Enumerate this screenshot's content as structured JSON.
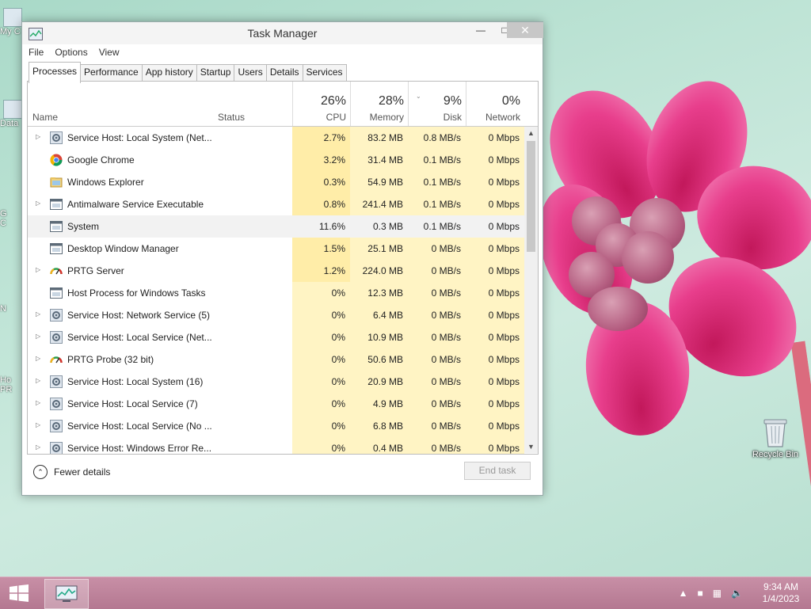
{
  "desktop": {
    "recycle_bin_label": "Recycle Bin",
    "left_labels": [
      "My C",
      "Data",
      "G",
      "C",
      "N",
      "Ho",
      "PR"
    ]
  },
  "window": {
    "title": "Task Manager",
    "menu": [
      "File",
      "Options",
      "View"
    ],
    "tabs": [
      "Processes",
      "Performance",
      "App history",
      "Startup",
      "Users",
      "Details",
      "Services"
    ],
    "active_tab": "Processes"
  },
  "columns": {
    "name": "Name",
    "status": "Status",
    "cpu": {
      "pct": "26%",
      "label": "CPU"
    },
    "memory": {
      "pct": "28%",
      "label": "Memory"
    },
    "disk": {
      "pct": "9%",
      "label": "Disk"
    },
    "network": {
      "pct": "0%",
      "label": "Network"
    }
  },
  "processes": [
    {
      "name": "Service Host: Local System (Net...",
      "cpu": "2.7%",
      "mem": "83.2 MB",
      "disk": "0.8 MB/s",
      "net": "0 Mbps",
      "icon": "gear-icon",
      "expandable": true
    },
    {
      "name": "Google Chrome",
      "cpu": "3.2%",
      "mem": "31.4 MB",
      "disk": "0.1 MB/s",
      "net": "0 Mbps",
      "icon": "chrome-icon",
      "expandable": false
    },
    {
      "name": "Windows Explorer",
      "cpu": "0.3%",
      "mem": "54.9 MB",
      "disk": "0.1 MB/s",
      "net": "0 Mbps",
      "icon": "folder-icon",
      "expandable": false
    },
    {
      "name": "Antimalware Service Executable",
      "cpu": "0.8%",
      "mem": "241.4 MB",
      "disk": "0.1 MB/s",
      "net": "0 Mbps",
      "icon": "window-icon",
      "expandable": true
    },
    {
      "name": "System",
      "cpu": "11.6%",
      "mem": "0.3 MB",
      "disk": "0.1 MB/s",
      "net": "0 Mbps",
      "icon": "window-icon",
      "expandable": false
    },
    {
      "name": "Desktop Window Manager",
      "cpu": "1.5%",
      "mem": "25.1 MB",
      "disk": "0 MB/s",
      "net": "0 Mbps",
      "icon": "window-icon",
      "expandable": false
    },
    {
      "name": "PRTG Server",
      "cpu": "1.2%",
      "mem": "224.0 MB",
      "disk": "0 MB/s",
      "net": "0 Mbps",
      "icon": "gauge-icon",
      "expandable": true
    },
    {
      "name": "Host Process for Windows Tasks",
      "cpu": "0%",
      "mem": "12.3 MB",
      "disk": "0 MB/s",
      "net": "0 Mbps",
      "icon": "window-icon",
      "expandable": false
    },
    {
      "name": "Service Host: Network Service (5)",
      "cpu": "0%",
      "mem": "6.4 MB",
      "disk": "0 MB/s",
      "net": "0 Mbps",
      "icon": "gear-icon",
      "expandable": true
    },
    {
      "name": "Service Host: Local Service (Net...",
      "cpu": "0%",
      "mem": "10.9 MB",
      "disk": "0 MB/s",
      "net": "0 Mbps",
      "icon": "gear-icon",
      "expandable": true
    },
    {
      "name": "PRTG Probe (32 bit)",
      "cpu": "0%",
      "mem": "50.6 MB",
      "disk": "0 MB/s",
      "net": "0 Mbps",
      "icon": "gauge-icon",
      "expandable": true
    },
    {
      "name": "Service Host: Local System (16)",
      "cpu": "0%",
      "mem": "20.9 MB",
      "disk": "0 MB/s",
      "net": "0 Mbps",
      "icon": "gear-icon",
      "expandable": true
    },
    {
      "name": "Service Host: Local Service (7)",
      "cpu": "0%",
      "mem": "4.9 MB",
      "disk": "0 MB/s",
      "net": "0 Mbps",
      "icon": "gear-icon",
      "expandable": true
    },
    {
      "name": "Service Host: Local Service (No ...",
      "cpu": "0%",
      "mem": "6.8 MB",
      "disk": "0 MB/s",
      "net": "0 Mbps",
      "icon": "gear-icon",
      "expandable": true
    },
    {
      "name": "Service Host: Windows Error Re...",
      "cpu": "0%",
      "mem": "0.4 MB",
      "disk": "0 MB/s",
      "net": "0 Mbps",
      "icon": "gear-icon",
      "expandable": true
    }
  ],
  "selected_row": 4,
  "footer": {
    "fewer_details": "Fewer details",
    "end_task": "End task"
  },
  "taskbar": {
    "time": "9:34 AM",
    "date": "1/4/2023"
  },
  "colors": {
    "heat_light": "#fff4c4",
    "heat_dark": "#ffeda8",
    "taskbar": "#b47891"
  }
}
